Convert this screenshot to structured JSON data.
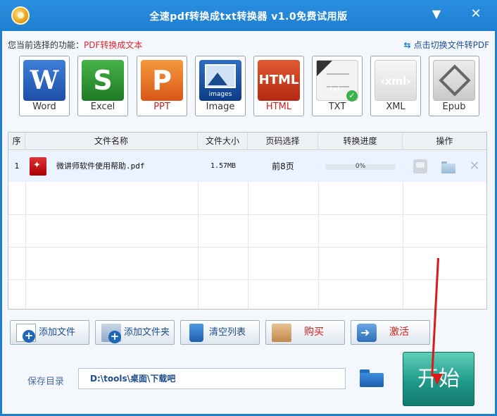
{
  "window": {
    "title": "全速pdf转换成txt转换器 v1.0免费试用版",
    "minimize_glyph": "▼",
    "close_glyph": "✕"
  },
  "function_bar": {
    "label": "您当前选择的功能：",
    "value": "PDF转换成文本",
    "switch_link": "点击切换文件转PDF",
    "switch_icon": "swap-arrows-icon"
  },
  "formats": [
    {
      "label": "Word",
      "glyph": "W",
      "icon": "word-icon"
    },
    {
      "label": "Excel",
      "glyph": "S",
      "icon": "excel-icon"
    },
    {
      "label": "PPT",
      "glyph": "P",
      "icon": "ppt-icon"
    },
    {
      "label": "Image",
      "glyph": "images",
      "icon": "image-icon"
    },
    {
      "label": "HTML",
      "glyph": "HTML",
      "icon": "html-icon"
    },
    {
      "label": "TXT",
      "glyph": "txt",
      "check": "✓",
      "icon": "txt-icon",
      "selected": true
    },
    {
      "label": "XML",
      "glyph": "‹xml›",
      "icon": "xml-icon"
    },
    {
      "label": "Epub",
      "glyph": "",
      "icon": "epub-icon"
    }
  ],
  "table": {
    "columns": [
      "序",
      "文件名称",
      "文件大小",
      "页码选择",
      "转换进度",
      "操作"
    ],
    "rows": [
      {
        "index": "1",
        "name": "微讲师软件使用帮助.pdf",
        "size": "1.57MB",
        "pages": "前8页",
        "progress": "0%",
        "progress_fraction": 0
      }
    ]
  },
  "buttons": {
    "add_file": "添加文件",
    "add_folder": "添加文件夹",
    "clear_list": "清空列表",
    "buy": "购买",
    "activate": "激活",
    "start": "开始"
  },
  "save": {
    "label": "保存目录",
    "path": "D:\\tools\\桌面\\下载吧"
  },
  "colors": {
    "titlebar": "#1e7fd0",
    "accent_red": "#d61b1b",
    "start_button": "#1f9a8a"
  }
}
